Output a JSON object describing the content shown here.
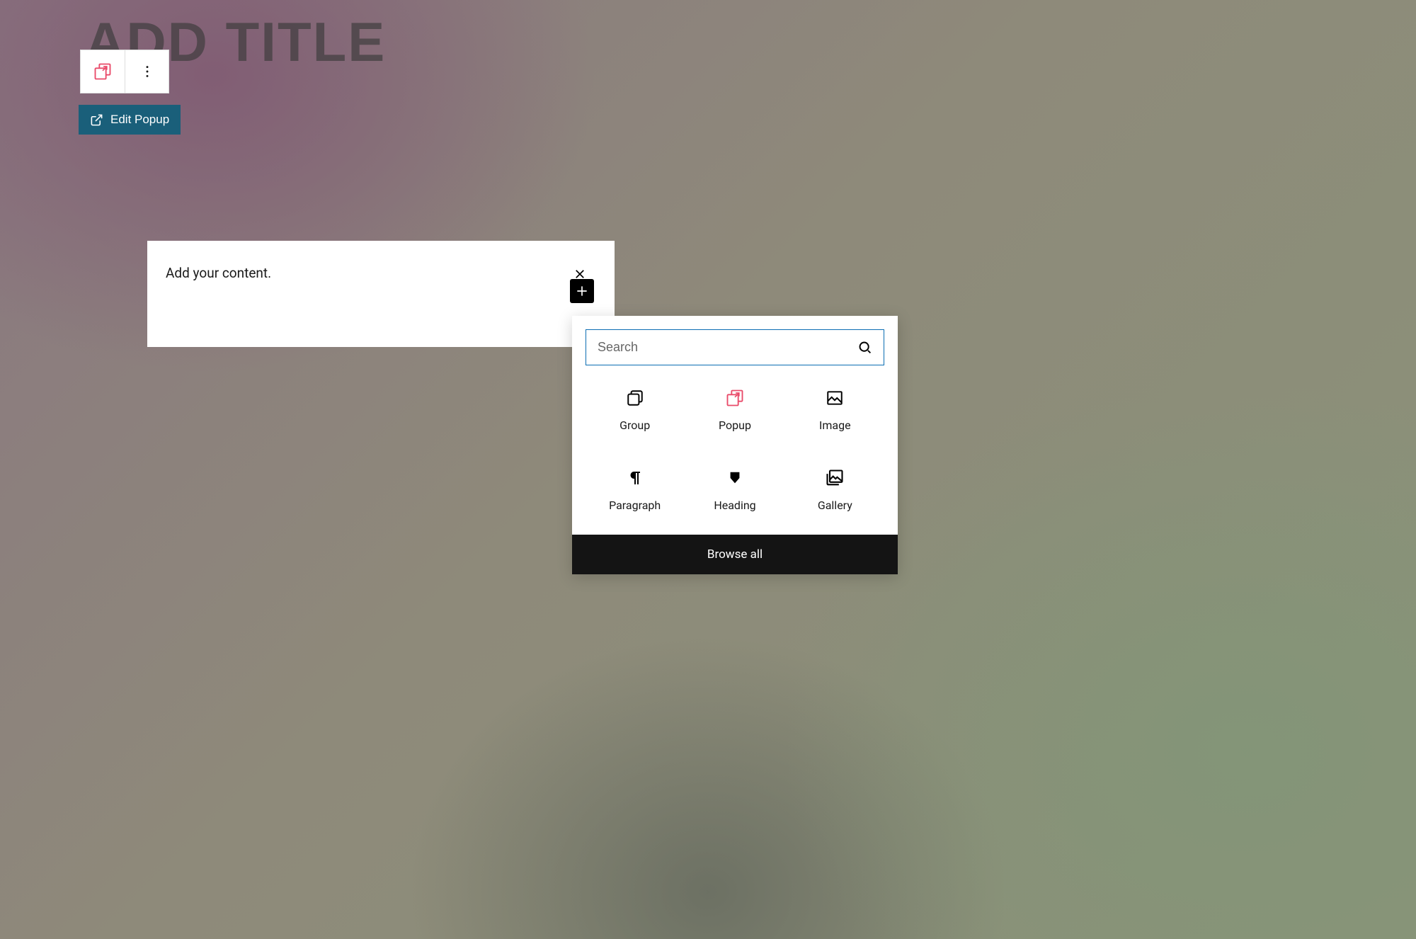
{
  "page": {
    "title_placeholder": "ADD TITLE"
  },
  "toolbar": {
    "popup_icon": "popup",
    "more_icon": "more",
    "edit_popup_label": "Edit Popup"
  },
  "content_block": {
    "placeholder": "Add your content."
  },
  "inserter": {
    "search_placeholder": "Search",
    "browse_all_label": "Browse all",
    "items": [
      {
        "label": "Group",
        "icon": "group"
      },
      {
        "label": "Popup",
        "icon": "popup"
      },
      {
        "label": "Image",
        "icon": "image"
      },
      {
        "label": "Paragraph",
        "icon": "paragraph"
      },
      {
        "label": "Heading",
        "icon": "heading"
      },
      {
        "label": "Gallery",
        "icon": "gallery"
      }
    ]
  },
  "colors": {
    "accent_pink": "#e94b6a",
    "button_teal": "#1a5f7a",
    "search_border": "#0a6db3"
  }
}
